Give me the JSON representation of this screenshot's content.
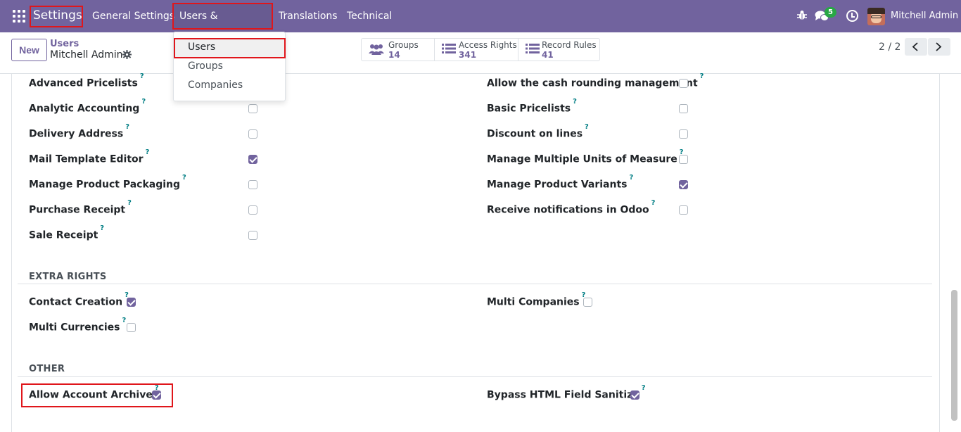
{
  "navbar": {
    "brand": "Settings",
    "menus": [
      "General Settings",
      "Users & Companies",
      "Translations",
      "Technical"
    ],
    "chat_count": "5",
    "user_name": "Mitchell Admin"
  },
  "dropdown": {
    "items": [
      "Users",
      "Groups",
      "Companies"
    ]
  },
  "control_panel": {
    "new_label": "New",
    "breadcrumb_parent": "Users",
    "breadcrumb_current": "Mitchell Admin",
    "stats": [
      {
        "label": "Groups",
        "value": "14"
      },
      {
        "label": "Access Rights",
        "value": "341"
      },
      {
        "label": "Record Rules",
        "value": "41"
      }
    ],
    "pager": "2 / 2"
  },
  "fields_left": [
    {
      "label": "Advanced Pricelists",
      "checked": false
    },
    {
      "label": "Analytic Accounting",
      "checked": false
    },
    {
      "label": "Delivery Address",
      "checked": false
    },
    {
      "label": "Mail Template Editor",
      "checked": true
    },
    {
      "label": "Manage Product Packaging",
      "checked": false
    },
    {
      "label": "Purchase Receipt",
      "checked": false
    },
    {
      "label": "Sale Receipt",
      "checked": false
    }
  ],
  "fields_right": [
    {
      "label": "Allow the cash rounding management",
      "checked": false
    },
    {
      "label": "Basic Pricelists",
      "checked": false
    },
    {
      "label": "Discount on lines",
      "checked": false
    },
    {
      "label": "Manage Multiple Units of Measure",
      "checked": false
    },
    {
      "label": "Manage Product Variants",
      "checked": true
    },
    {
      "label": "Receive notifications in Odoo",
      "checked": false
    }
  ],
  "extra_rights": {
    "title": "EXTRA RIGHTS",
    "left": [
      {
        "label": "Contact Creation",
        "checked": true
      },
      {
        "label": "Multi Currencies",
        "checked": false
      }
    ],
    "right": [
      {
        "label": "Multi Companies",
        "checked": false
      }
    ]
  },
  "other": {
    "title": "OTHER",
    "left": [
      {
        "label": "Allow Account Archive",
        "checked": true
      }
    ],
    "right": [
      {
        "label": "Bypass HTML Field Sanitize",
        "checked": true
      }
    ]
  },
  "help_mark": "?",
  "colors": {
    "navbar": "#71639e",
    "accent": "#71639e",
    "highlight": "#e0161b",
    "badge": "#28a745"
  }
}
